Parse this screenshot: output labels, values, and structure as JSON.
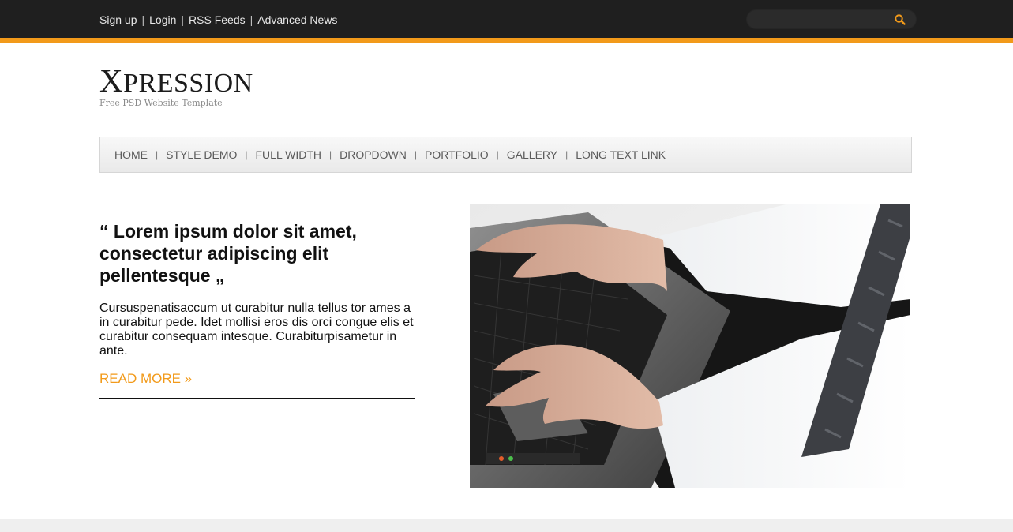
{
  "topbar": {
    "links": [
      "Sign up",
      "Login",
      "RSS Feeds",
      "Advanced News"
    ],
    "separator": "|",
    "search": {
      "value": "",
      "placeholder": ""
    },
    "accent_color": "#f29a1a",
    "bg_color": "#1f1f1f",
    "search_icon": "search-icon"
  },
  "logo": {
    "initial": "X",
    "rest": "PRESSION",
    "tagline": "Free PSD Website Template"
  },
  "nav": {
    "items": [
      "HOME",
      "STYLE DEMO",
      "FULL WIDTH",
      "DROPDOWN",
      "PORTFOLIO",
      "GALLERY",
      "LONG TEXT LINK"
    ],
    "separator": "|"
  },
  "feature": {
    "quote": "“ Lorem ipsum dolor sit amet, consectetur adipiscing elit pellentesque „",
    "body": "Cursuspenatisaccum ut curabitur nulla tellus tor ames a in curabitur pede. Idet mollisi eros dis orci congue elis et curabitur consequam intesque. Curabiturpisametur in ante.",
    "read_more": "READ MORE »",
    "image": "photo of hands typing on a laptop keyboard"
  }
}
